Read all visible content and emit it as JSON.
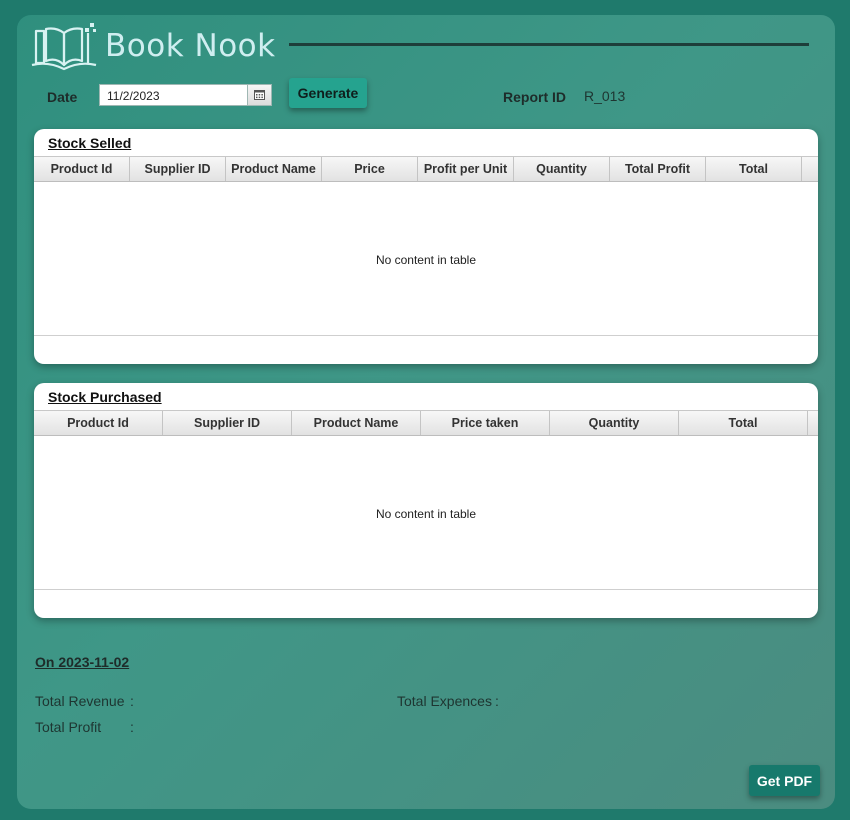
{
  "app": {
    "title": "Book Nook"
  },
  "controls": {
    "date_label": "Date",
    "date_value": "11/2/2023",
    "generate_label": "Generate",
    "report_id_label": "Report ID",
    "report_id_value": "R_013"
  },
  "stock_selled": {
    "title": "Stock Selled",
    "columns": [
      "Product Id",
      "Supplier ID",
      "Product Name",
      "Price",
      "Profit per Unit",
      "Quantity",
      "Total Profit",
      "Total"
    ],
    "empty_text": "No content in table"
  },
  "stock_purchased": {
    "title": "Stock Purchased",
    "columns": [
      "Product Id",
      "Supplier ID",
      "Product Name",
      "Price taken",
      "Quantity",
      "Total"
    ],
    "empty_text": "No content in table"
  },
  "summary": {
    "heading": "On 2023-11-02",
    "total_revenue_label": "Total Revenue",
    "total_expences_label": "Total Expences",
    "total_profit_label": "Total Profit",
    "colon": ":"
  },
  "footer": {
    "get_pdf_label": "Get PDF"
  },
  "colors": {
    "background": "#1f7a6c",
    "accent": "#25a38f",
    "pdf_button": "#17796c"
  }
}
